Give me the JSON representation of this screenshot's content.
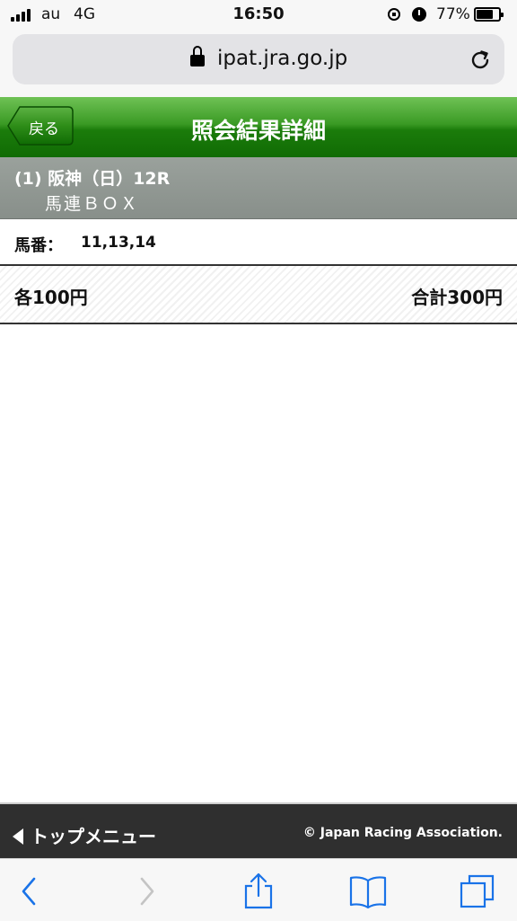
{
  "status_bar": {
    "carrier": "au",
    "network": "4G",
    "time": "16:50",
    "battery_percent": "77%",
    "battery_level": 0.77,
    "icons": [
      "signal-icon",
      "rotation-lock-icon",
      "alarm-icon",
      "battery-icon"
    ]
  },
  "browser": {
    "url": "ipat.jra.go.jp",
    "icons": [
      "padlock-icon",
      "reload-icon"
    ]
  },
  "header": {
    "back_label": "戻る",
    "title": "照会結果詳細"
  },
  "race": {
    "line1": "(1) 阪神（日）12R",
    "line2": "馬連ＢＯＸ"
  },
  "horses": {
    "label": "馬番：",
    "value": "11,13,14"
  },
  "amount": {
    "each": "各100円",
    "total": "合計300円"
  },
  "footer": {
    "top_menu": "トップメニュー",
    "copyright": "© Japan Racing Association."
  },
  "toolbar": {
    "icons": [
      "back-arrow-icon",
      "forward-arrow-icon",
      "share-icon",
      "bookmarks-icon",
      "tabs-icon"
    ]
  },
  "colors": {
    "header_green": "#1b7c0b",
    "race_gray": "#8e9590",
    "footer_dark": "#2f2f2f",
    "ios_blue": "#1a73e8"
  }
}
